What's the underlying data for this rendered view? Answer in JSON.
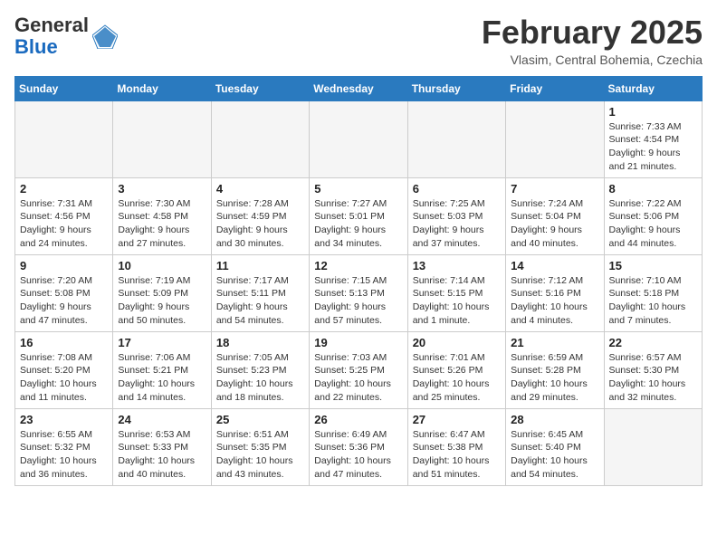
{
  "logo": {
    "general": "General",
    "blue": "Blue"
  },
  "title": "February 2025",
  "location": "Vlasim, Central Bohemia, Czechia",
  "days_of_week": [
    "Sunday",
    "Monday",
    "Tuesday",
    "Wednesday",
    "Thursday",
    "Friday",
    "Saturday"
  ],
  "weeks": [
    [
      {
        "day": "",
        "info": ""
      },
      {
        "day": "",
        "info": ""
      },
      {
        "day": "",
        "info": ""
      },
      {
        "day": "",
        "info": ""
      },
      {
        "day": "",
        "info": ""
      },
      {
        "day": "",
        "info": ""
      },
      {
        "day": "1",
        "info": "Sunrise: 7:33 AM\nSunset: 4:54 PM\nDaylight: 9 hours and 21 minutes."
      }
    ],
    [
      {
        "day": "2",
        "info": "Sunrise: 7:31 AM\nSunset: 4:56 PM\nDaylight: 9 hours and 24 minutes."
      },
      {
        "day": "3",
        "info": "Sunrise: 7:30 AM\nSunset: 4:58 PM\nDaylight: 9 hours and 27 minutes."
      },
      {
        "day": "4",
        "info": "Sunrise: 7:28 AM\nSunset: 4:59 PM\nDaylight: 9 hours and 30 minutes."
      },
      {
        "day": "5",
        "info": "Sunrise: 7:27 AM\nSunset: 5:01 PM\nDaylight: 9 hours and 34 minutes."
      },
      {
        "day": "6",
        "info": "Sunrise: 7:25 AM\nSunset: 5:03 PM\nDaylight: 9 hours and 37 minutes."
      },
      {
        "day": "7",
        "info": "Sunrise: 7:24 AM\nSunset: 5:04 PM\nDaylight: 9 hours and 40 minutes."
      },
      {
        "day": "8",
        "info": "Sunrise: 7:22 AM\nSunset: 5:06 PM\nDaylight: 9 hours and 44 minutes."
      }
    ],
    [
      {
        "day": "9",
        "info": "Sunrise: 7:20 AM\nSunset: 5:08 PM\nDaylight: 9 hours and 47 minutes."
      },
      {
        "day": "10",
        "info": "Sunrise: 7:19 AM\nSunset: 5:09 PM\nDaylight: 9 hours and 50 minutes."
      },
      {
        "day": "11",
        "info": "Sunrise: 7:17 AM\nSunset: 5:11 PM\nDaylight: 9 hours and 54 minutes."
      },
      {
        "day": "12",
        "info": "Sunrise: 7:15 AM\nSunset: 5:13 PM\nDaylight: 9 hours and 57 minutes."
      },
      {
        "day": "13",
        "info": "Sunrise: 7:14 AM\nSunset: 5:15 PM\nDaylight: 10 hours and 1 minute."
      },
      {
        "day": "14",
        "info": "Sunrise: 7:12 AM\nSunset: 5:16 PM\nDaylight: 10 hours and 4 minutes."
      },
      {
        "day": "15",
        "info": "Sunrise: 7:10 AM\nSunset: 5:18 PM\nDaylight: 10 hours and 7 minutes."
      }
    ],
    [
      {
        "day": "16",
        "info": "Sunrise: 7:08 AM\nSunset: 5:20 PM\nDaylight: 10 hours and 11 minutes."
      },
      {
        "day": "17",
        "info": "Sunrise: 7:06 AM\nSunset: 5:21 PM\nDaylight: 10 hours and 14 minutes."
      },
      {
        "day": "18",
        "info": "Sunrise: 7:05 AM\nSunset: 5:23 PM\nDaylight: 10 hours and 18 minutes."
      },
      {
        "day": "19",
        "info": "Sunrise: 7:03 AM\nSunset: 5:25 PM\nDaylight: 10 hours and 22 minutes."
      },
      {
        "day": "20",
        "info": "Sunrise: 7:01 AM\nSunset: 5:26 PM\nDaylight: 10 hours and 25 minutes."
      },
      {
        "day": "21",
        "info": "Sunrise: 6:59 AM\nSunset: 5:28 PM\nDaylight: 10 hours and 29 minutes."
      },
      {
        "day": "22",
        "info": "Sunrise: 6:57 AM\nSunset: 5:30 PM\nDaylight: 10 hours and 32 minutes."
      }
    ],
    [
      {
        "day": "23",
        "info": "Sunrise: 6:55 AM\nSunset: 5:32 PM\nDaylight: 10 hours and 36 minutes."
      },
      {
        "day": "24",
        "info": "Sunrise: 6:53 AM\nSunset: 5:33 PM\nDaylight: 10 hours and 40 minutes."
      },
      {
        "day": "25",
        "info": "Sunrise: 6:51 AM\nSunset: 5:35 PM\nDaylight: 10 hours and 43 minutes."
      },
      {
        "day": "26",
        "info": "Sunrise: 6:49 AM\nSunset: 5:36 PM\nDaylight: 10 hours and 47 minutes."
      },
      {
        "day": "27",
        "info": "Sunrise: 6:47 AM\nSunset: 5:38 PM\nDaylight: 10 hours and 51 minutes."
      },
      {
        "day": "28",
        "info": "Sunrise: 6:45 AM\nSunset: 5:40 PM\nDaylight: 10 hours and 54 minutes."
      },
      {
        "day": "",
        "info": ""
      }
    ]
  ]
}
